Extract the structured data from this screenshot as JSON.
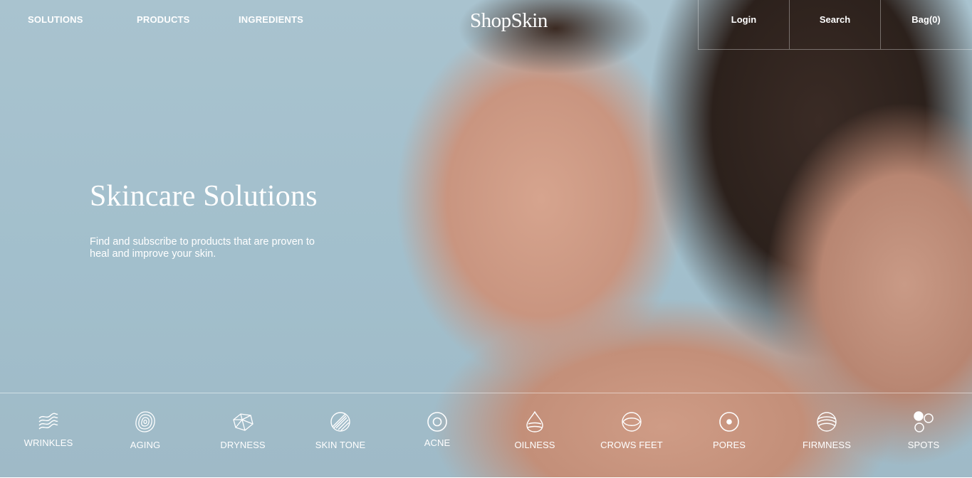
{
  "nav": {
    "solutions": "SOLUTIONS",
    "products": "PRODUCTS",
    "ingredients": "INGREDIENTS",
    "logo": "ShopSkin",
    "login": "Login",
    "search": "Search",
    "bag": "Bag(0)"
  },
  "hero": {
    "title": "Skincare Solutions",
    "subtitle": "Find and subscribe to products that are proven to heal and improve your skin."
  },
  "concerns": [
    {
      "label": "WRINKLES",
      "icon": "wrinkles-icon"
    },
    {
      "label": "AGING",
      "icon": "aging-icon"
    },
    {
      "label": "DRYNESS",
      "icon": "dryness-icon"
    },
    {
      "label": "SKIN TONE",
      "icon": "skin-tone-icon"
    },
    {
      "label": "ACNE",
      "icon": "acne-icon"
    },
    {
      "label": "OILNESS",
      "icon": "oilness-icon"
    },
    {
      "label": "CROWS FEET",
      "icon": "crows-feet-icon"
    },
    {
      "label": "PORES",
      "icon": "pores-icon"
    },
    {
      "label": "FIRMNESS",
      "icon": "firmness-icon"
    },
    {
      "label": "SPOTS",
      "icon": "spots-icon"
    }
  ],
  "colors": {
    "background": "#a6c1cd",
    "text": "#ffffff"
  }
}
